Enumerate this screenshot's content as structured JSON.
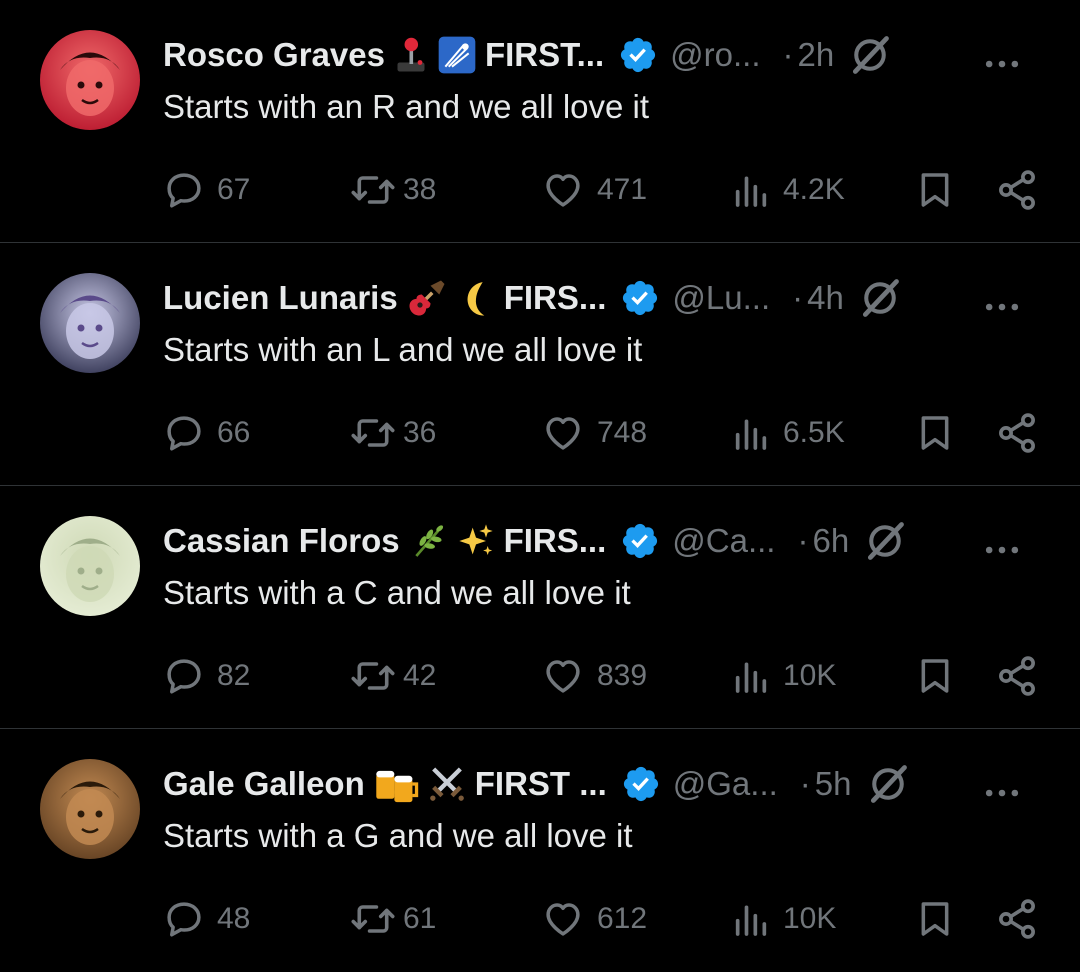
{
  "posts": [
    {
      "name": "Rosco Graves",
      "emoji_icons": [
        "joystick-icon",
        "shooting-star-icon"
      ],
      "first": "FIRST...",
      "handle": "@ro...",
      "dot": "·",
      "time": "2h",
      "text": "Starts with an R and we all love it",
      "replies": "67",
      "reposts": "38",
      "likes": "471",
      "views": "4.2K",
      "avatar_colors": [
        "#b5122a",
        "#f06a6a",
        "#2a0a0a"
      ]
    },
    {
      "name": "Lucien Lunaris",
      "emoji_icons": [
        "guitar-icon",
        "crescent-moon-icon"
      ],
      "first": "FIRS...",
      "handle": "@Lu...",
      "dot": "·",
      "time": "4h",
      "text": "Starts with an L and we all love it",
      "replies": "66",
      "reposts": "36",
      "likes": "748",
      "views": "6.5K",
      "avatar_colors": [
        "#2a2c4a",
        "#c8c8e6",
        "#5a4a8a"
      ]
    },
    {
      "name": "Cassian Floros",
      "emoji_icons": [
        "herb-icon",
        "sparkles-icon"
      ],
      "first": "FIRS...",
      "handle": "@Ca...",
      "dot": "·",
      "time": "6h",
      "text": "Starts with a C and we all love it",
      "replies": "82",
      "reposts": "42",
      "likes": "839",
      "views": "10K",
      "avatar_colors": [
        "#e8efd8",
        "#cfd9b6",
        "#9fae8a"
      ]
    },
    {
      "name": "Gale Galleon",
      "emoji_icons": [
        "beer-mugs-icon",
        "crossed-swords-icon"
      ],
      "first": "FIRST ...",
      "handle": "@Ga...",
      "dot": "·",
      "time": "5h",
      "text": "Starts with a G and we all love it",
      "replies": "48",
      "reposts": "61",
      "likes": "612",
      "views": "10K",
      "avatar_colors": [
        "#5a3a1e",
        "#c28a52",
        "#2a1a0a"
      ]
    }
  ],
  "colors": {
    "background": "#000000",
    "text_primary": "#e7e9ea",
    "text_secondary": "#71767b",
    "verified_blue": "#1d9bf0",
    "divider": "#2f3336"
  }
}
